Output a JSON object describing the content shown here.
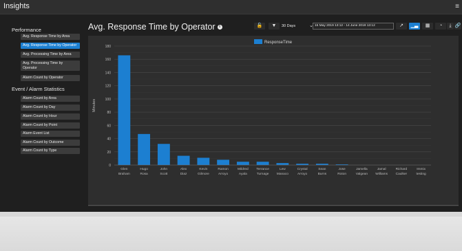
{
  "topbar": {
    "title": "Insights",
    "menu_icon": "hamburger-icon"
  },
  "sidebar": {
    "sections": [
      {
        "label": "Performance"
      },
      {
        "label": "Event / Alarm Statistics"
      }
    ],
    "performance_items": [
      {
        "label": "Avg. Response Time by Area",
        "active": false
      },
      {
        "label": "Avg. Response Time by Operator",
        "active": true
      },
      {
        "label": "Avg. Processing Time by Area",
        "active": false
      },
      {
        "label": "Avg. Processing Time by Operator",
        "active": false
      },
      {
        "label": "Alarm Count by Operator",
        "active": false
      }
    ],
    "event_items": [
      {
        "label": "Alarm Count by Area"
      },
      {
        "label": "Alarm Count by Day"
      },
      {
        "label": "Alarm Count by Hour"
      },
      {
        "label": "Alarm Count by Point"
      },
      {
        "label": "Alarm Event List"
      },
      {
        "label": "Alarm Count by Outcome"
      },
      {
        "label": "Alarm Count by Type"
      }
    ]
  },
  "main": {
    "title": "Avg. Response Time by Operator",
    "toolbar": {
      "range_label": "30 Days",
      "date_range": "15 May 2019 13:12 - 14 June 2019 13:12",
      "icons": [
        "lock-icon",
        "filter-icon",
        "line-chart-icon",
        "bar-chart-icon",
        "table-icon",
        "pie-chart-icon",
        "download-icon",
        "link-icon"
      ]
    }
  },
  "colors": {
    "accent": "#1c7fd1",
    "panel": "#2e2e2e",
    "background": "#1f1f1f"
  },
  "chart_data": {
    "type": "bar",
    "title": "Avg. Response Time by Operator",
    "xlabel": "",
    "ylabel": "Minutes",
    "ylim": [
      0,
      180
    ],
    "yticks": [
      0,
      20,
      40,
      60,
      80,
      100,
      120,
      140,
      160,
      180
    ],
    "grid": true,
    "legend": "top-center",
    "categories": [
      "Glen Braham",
      "Hugo Rosa",
      "John Scott",
      "Alex Diaz",
      "Kevin Gilmore",
      "Ramon Arroyo",
      "Mildred Ayala",
      "Terrance Turnage",
      "Lew Manaco",
      "Crystal Arroyo",
      "Sean Burns",
      "Jose Roton",
      "Jamella Valgean",
      "Jamal Williams",
      "Richard Caulker",
      "Immix testing"
    ],
    "series": [
      {
        "name": "ResponseTime",
        "values": [
          166,
          47,
          32,
          14,
          11,
          8,
          5,
          5,
          3,
          2,
          2,
          1,
          0,
          0,
          0,
          0
        ]
      }
    ]
  }
}
